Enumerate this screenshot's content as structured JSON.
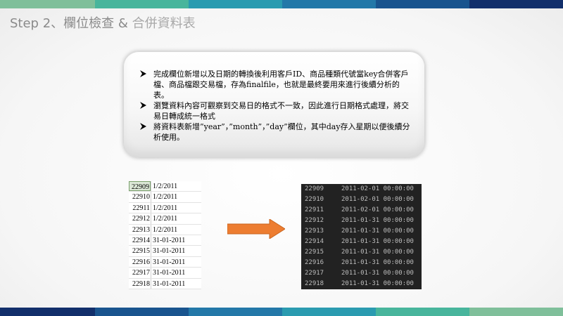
{
  "title": {
    "part1": "Step 2、欄位檢查 & ",
    "part2": "合併資料表"
  },
  "colors": {
    "top_band": [
      "#7fbf9a",
      "#48b59c",
      "#2a9bb0",
      "#2378a8",
      "#19548e",
      "#122f6b"
    ],
    "bottom_band": [
      "#122f6b",
      "#19548e",
      "#2378a8",
      "#2a9bb0",
      "#48b59c",
      "#7fbf9a"
    ],
    "arrow": "#ed7d31",
    "terminal_bg": "#222222"
  },
  "bullets": [
    "完成欄位新增以及日期的轉換後利用客戶ID、商品種類代號當key合併客戶檔、商品檔跟交易檔，存為finalfile，也就是最終要用來進行後續分析的表。",
    "瀏覽資料內容可觀察到交易日的格式不一致，因此進行日期格式處理，將交易日轉成統一格式",
    "將資料表新增”year”，”month”，”day”欄位，其中day存入星期以便後續分析使用。"
  ],
  "excel_rows": [
    {
      "id": "22909",
      "value": "1/2/2011"
    },
    {
      "id": "22910",
      "value": "1/2/2011"
    },
    {
      "id": "22911",
      "value": "1/2/2011"
    },
    {
      "id": "22912",
      "value": "1/2/2011"
    },
    {
      "id": "22913",
      "value": "1/2/2011"
    },
    {
      "id": "22914",
      "value": "31-01-2011"
    },
    {
      "id": "22915",
      "value": "31-01-2011"
    },
    {
      "id": "22916",
      "value": "31-01-2011"
    },
    {
      "id": "22917",
      "value": "31-01-2011"
    },
    {
      "id": "22918",
      "value": "31-01-2011"
    }
  ],
  "terminal_rows": [
    {
      "id": "22909",
      "value": "2011-02-01 00:00:00"
    },
    {
      "id": "22910",
      "value": "2011-02-01 00:00:00"
    },
    {
      "id": "22911",
      "value": "2011-02-01 00:00:00"
    },
    {
      "id": "22912",
      "value": "2011-01-31 00:00:00"
    },
    {
      "id": "22913",
      "value": "2011-01-31 00:00:00"
    },
    {
      "id": "22914",
      "value": "2011-01-31 00:00:00"
    },
    {
      "id": "22915",
      "value": "2011-01-31 00:00:00"
    },
    {
      "id": "22916",
      "value": "2011-01-31 00:00:00"
    },
    {
      "id": "22917",
      "value": "2011-01-31 00:00:00"
    },
    {
      "id": "22918",
      "value": "2011-01-31 00:00:00"
    }
  ]
}
